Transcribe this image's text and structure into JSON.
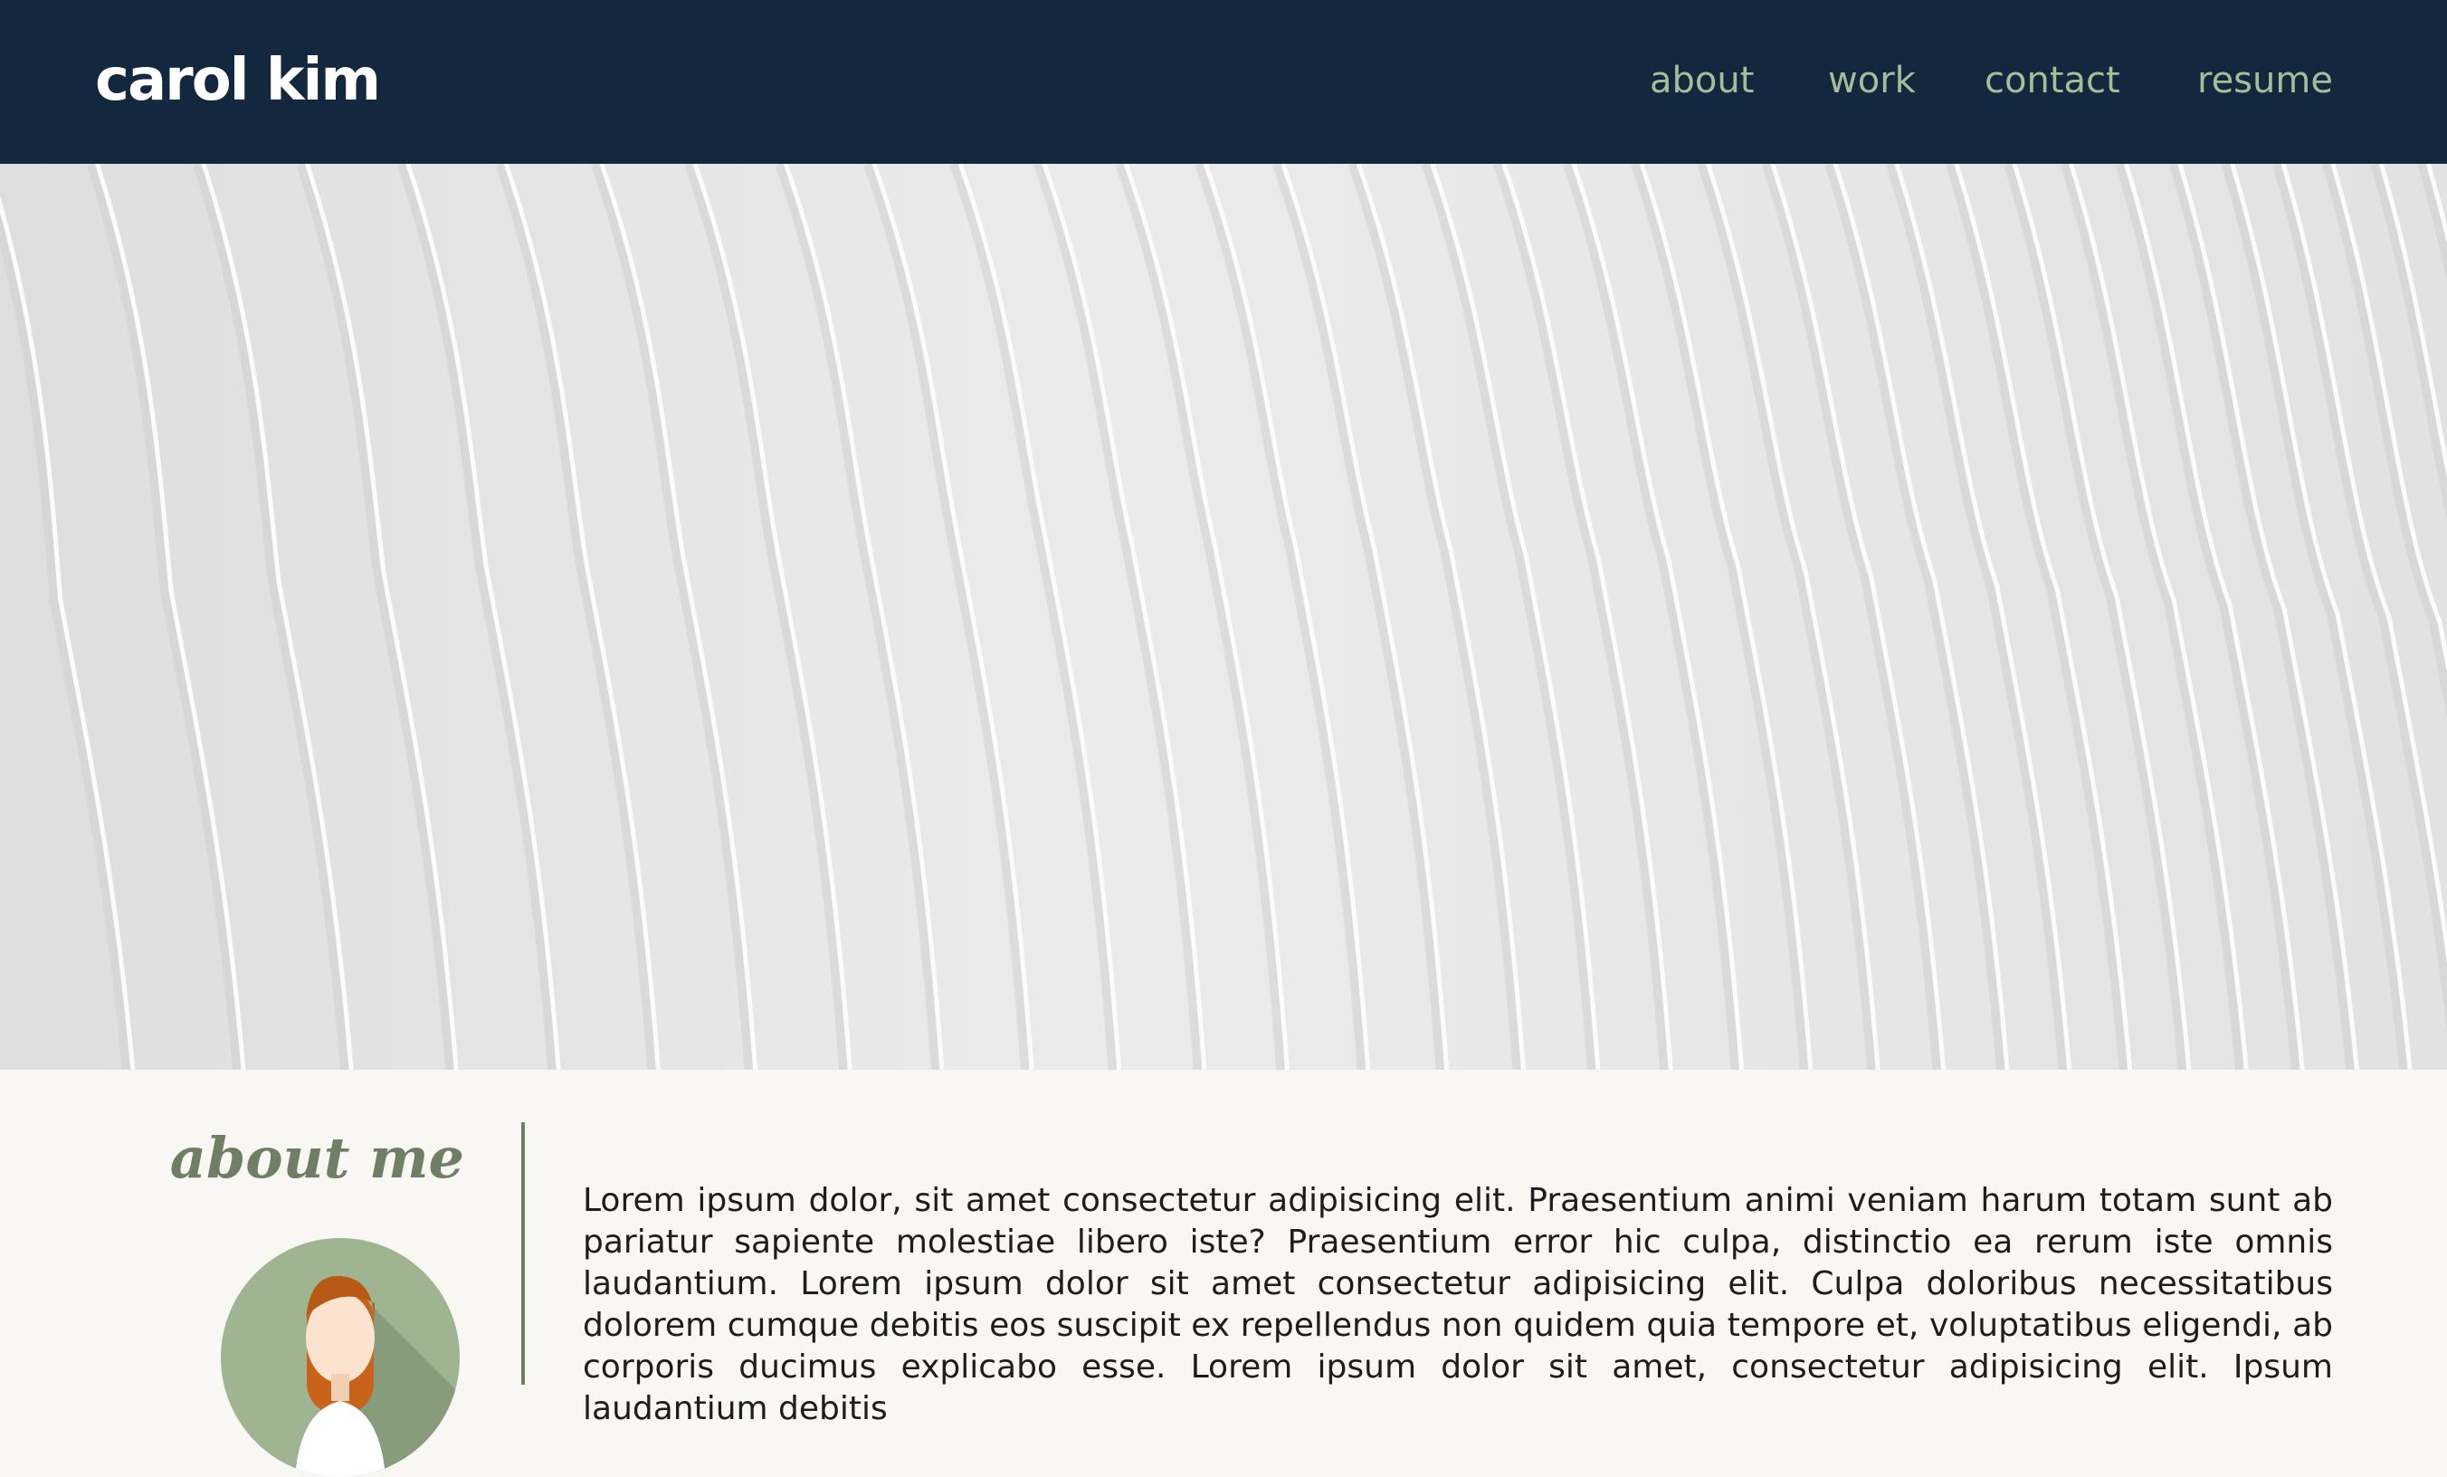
{
  "header": {
    "brand": "carol kim",
    "nav": [
      {
        "label": "about"
      },
      {
        "label": "work"
      },
      {
        "label": "contact"
      },
      {
        "label": "resume"
      }
    ]
  },
  "about": {
    "heading": "about me",
    "body": "Lorem ipsum dolor, sit amet consectetur adipisicing elit. Praesentium animi veniam harum totam sunt ab pariatur sapiente molestiae libero iste? Praesentium error hic culpa, distinctio ea rerum iste omnis laudantium. Lorem ipsum dolor sit amet consectetur adipisicing elit. Culpa doloribus necessitatibus dolorem cumque debitis eos suscipit ex repellendus non quidem quia tempore et, voluptatibus eligendi, ab corporis ducimus explicabo esse. Lorem ipsum dolor sit amet, consectetur adipisicing elit. Ipsum laudantium debitis"
  },
  "colors": {
    "navbar": "#13283e",
    "nav_link": "#a7bc99",
    "accent": "#6f7f64",
    "page_bg": "#f8f7f4"
  }
}
